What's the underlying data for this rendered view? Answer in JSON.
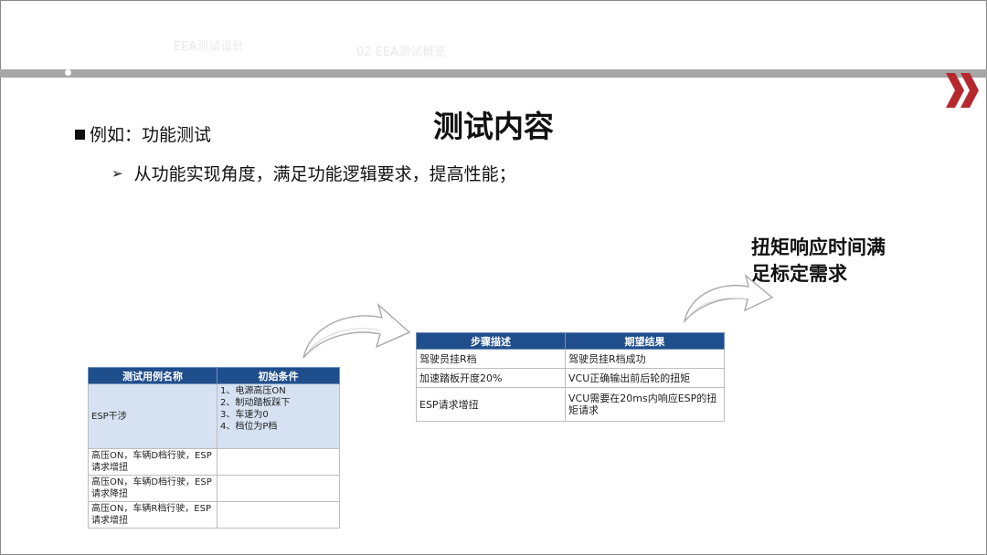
{
  "header": {
    "faded_left": "EEA测试设计",
    "faded_right": "02 EEA测试概览"
  },
  "slide": {
    "title": "测试内容",
    "bullet": "例如：功能测试",
    "sub_bullet": "从功能实现角度，满足功能逻辑要求，提高性能；",
    "note_line1": "扭矩响应时间满",
    "note_line2": "足标定需求"
  },
  "colors": {
    "accent_red": "#b5282d",
    "table_header": "#1f4e8c",
    "highlight_cell": "#d6e2f2",
    "header_bar": "#a6a6a6"
  },
  "test_case_table": {
    "headers": [
      "测试用例名称",
      "初始条件"
    ],
    "rows": [
      {
        "name": "ESP干涉",
        "conditions": [
          "1、电源高压ON",
          "2、制动踏板踩下",
          "3、车速为0",
          "4、档位为P档"
        ]
      },
      {
        "name": "高压ON，车辆D档行驶，ESP请求增扭",
        "conditions": []
      },
      {
        "name": "高压ON，车辆D档行驶，ESP请求降扭",
        "conditions": []
      },
      {
        "name": "高压ON，车辆R档行驶，ESP请求增扭",
        "conditions": []
      }
    ]
  },
  "steps_table": {
    "headers": [
      "步骤描述",
      "期望结果"
    ],
    "rows": [
      {
        "step": "驾驶员挂R档",
        "expected": "驾驶员挂R档成功"
      },
      {
        "step": "加速踏板开度20%",
        "expected": "VCU正确输出前后轮的扭矩"
      },
      {
        "step": "ESP请求增扭",
        "expected": "VCU需要在20ms内响应ESP的扭矩请求"
      }
    ]
  }
}
